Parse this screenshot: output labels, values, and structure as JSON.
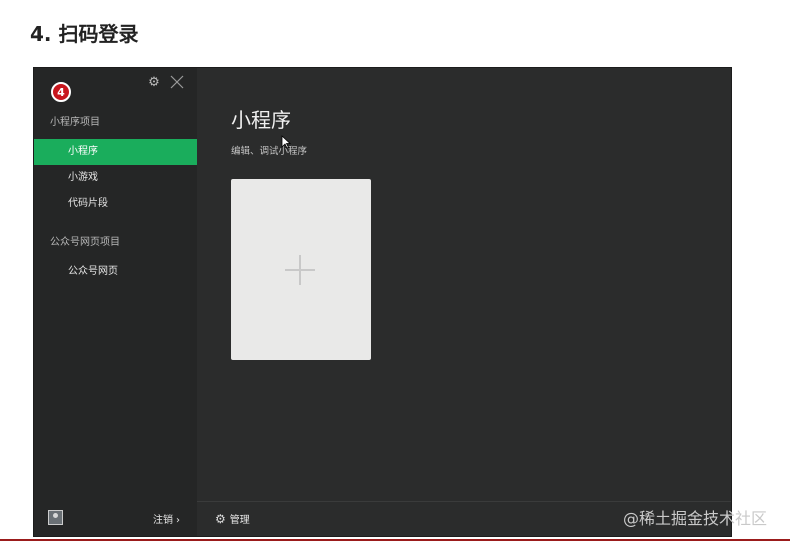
{
  "slide": {
    "title": "4. 扫码登录"
  },
  "sidebar": {
    "badge": "4",
    "sections": [
      {
        "label": "小程序项目",
        "items": [
          "小程序",
          "小游戏",
          "代码片段"
        ]
      },
      {
        "label": "公众号网页项目",
        "items": [
          "公众号网页"
        ]
      }
    ],
    "footer": {
      "logout_label": "注销",
      "logout_chevron": "›"
    }
  },
  "main": {
    "title": "小程序",
    "subtitle": "编辑、调试小程序",
    "footer": {
      "manage_label": "管理"
    }
  },
  "watermark": "@稀土掘金技术社区",
  "colors": {
    "accent": "#1aad5c",
    "badge": "#c8161d",
    "sidebar_bg": "#252626",
    "main_bg": "#2b2c2c"
  }
}
